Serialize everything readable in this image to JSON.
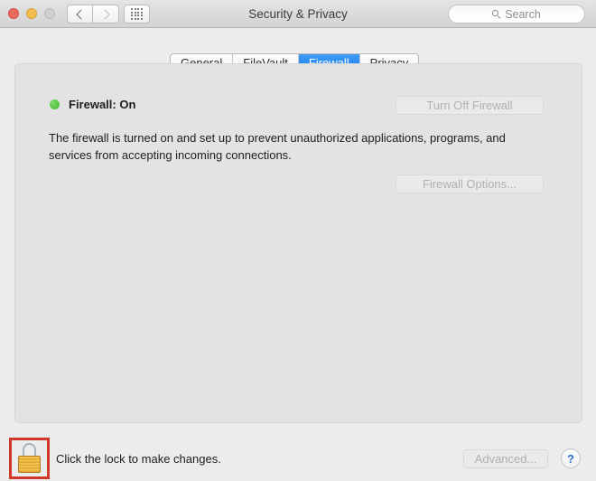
{
  "window": {
    "title": "Security & Privacy",
    "controls": {
      "close_label": "close",
      "minimize_label": "minimize",
      "zoom_label": "zoom"
    },
    "nav": {
      "back_label": "Back",
      "forward_label": "Forward",
      "show_all_label": "Show All"
    },
    "search": {
      "placeholder": "Search",
      "value": "",
      "icon": "search-icon"
    }
  },
  "tabs": [
    {
      "label": "General",
      "active": false
    },
    {
      "label": "FileVault",
      "active": false
    },
    {
      "label": "Firewall",
      "active": true
    },
    {
      "label": "Privacy",
      "active": false
    }
  ],
  "panel": {
    "status": {
      "text": "Firewall: On",
      "indicator_color": "#54c13f",
      "indicator_name": "status-dot-on"
    },
    "description": "The firewall is turned on and set up to prevent unauthorized applications, programs, and services from accepting incoming connections.",
    "turn_off_button": {
      "label": "Turn Off Firewall",
      "enabled": false
    },
    "options_button": {
      "label": "Firewall Options...",
      "enabled": false
    }
  },
  "footer": {
    "lock": {
      "state": "locked",
      "icon": "lock-closed-icon",
      "highlight_color": "#d0382c"
    },
    "lock_message": "Click the lock to make changes.",
    "advanced_button": {
      "label": "Advanced...",
      "enabled": false
    },
    "help_button": {
      "label": "?"
    }
  },
  "colors": {
    "accent": "#1a7ef0",
    "window_bg": "#ececec",
    "panel_bg": "#e3e3e3",
    "help_blue": "#2d72c8",
    "lock_gold": "#e0a830"
  }
}
